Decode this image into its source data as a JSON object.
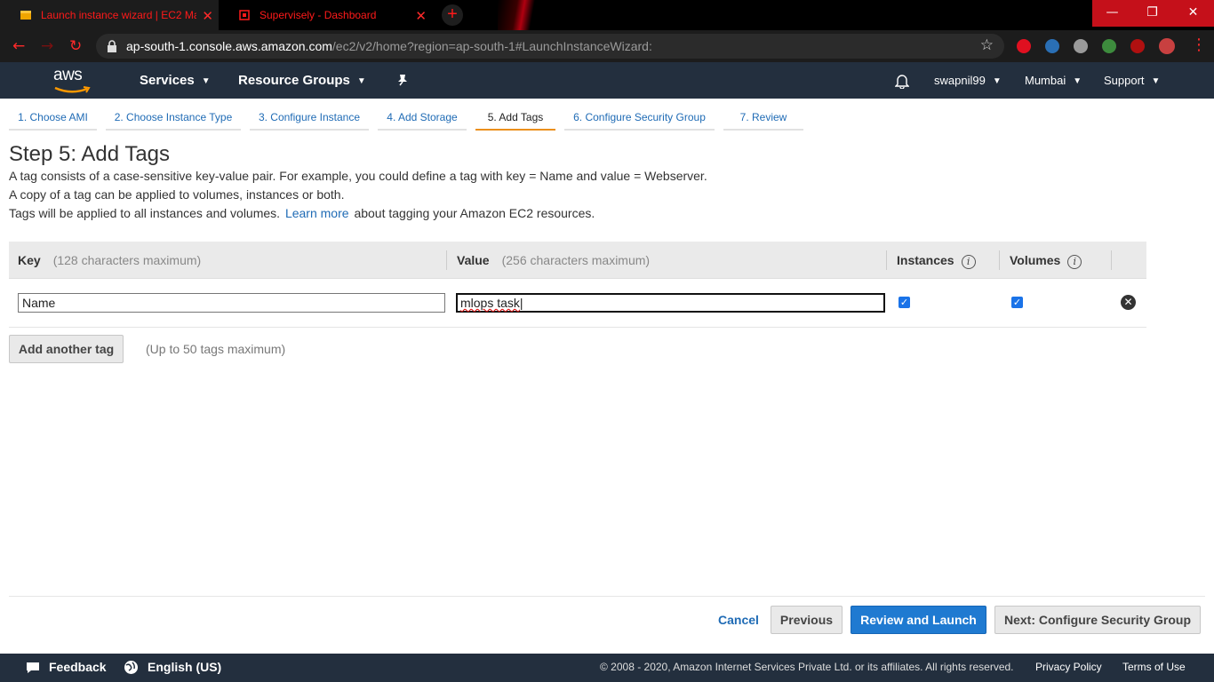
{
  "browser": {
    "tabs": [
      {
        "title": "Launch instance wizard | EC2 Ma",
        "icon": "aws-box-icon"
      },
      {
        "title": "Supervisely - Dashboard",
        "icon": "supervisely-icon"
      }
    ],
    "new_tab": "+",
    "url_host": "ap-south-1.console.aws.amazon.com",
    "url_path": "/ec2/v2/home?region=ap-south-1#LaunchInstanceWizard:"
  },
  "header": {
    "logo": "aws",
    "services": "Services",
    "resource_groups": "Resource Groups",
    "user": "swapnil99",
    "region": "Mumbai",
    "support": "Support"
  },
  "wizard": {
    "steps": [
      "1. Choose AMI",
      "2. Choose Instance Type",
      "3. Configure Instance",
      "4. Add Storage",
      "5. Add Tags",
      "6. Configure Security Group",
      "7. Review"
    ],
    "active_step": "5. Add Tags"
  },
  "page": {
    "title": "Step 5: Add Tags",
    "desc1": "A tag consists of a case-sensitive key-value pair. For example, you could define a tag with key = Name and value = Webserver.",
    "desc2": "A copy of a tag can be applied to volumes, instances or both.",
    "desc3_pre": "Tags will be applied to all instances and volumes.",
    "learn_more": "Learn more",
    "desc3_post": "about tagging your Amazon EC2 resources."
  },
  "table": {
    "key_header": "Key",
    "key_hint": "(128 characters maximum)",
    "value_header": "Value",
    "value_hint": "(256 characters maximum)",
    "instances_header": "Instances",
    "volumes_header": "Volumes",
    "rows": [
      {
        "key": "Name",
        "value": "mlops task",
        "instances": true,
        "volumes": true
      }
    ]
  },
  "actions": {
    "add_tag": "Add another tag",
    "add_tag_note": "(Up to 50 tags maximum)",
    "cancel": "Cancel",
    "previous": "Previous",
    "review_launch": "Review and Launch",
    "next": "Next: Configure Security Group"
  },
  "footer": {
    "feedback": "Feedback",
    "language": "English (US)",
    "copyright": "© 2008 - 2020, Amazon Internet Services Private Ltd. or its affiliates. All rights reserved.",
    "privacy": "Privacy Policy",
    "terms": "Terms of Use"
  },
  "colors": {
    "aws_navy": "#232f3e",
    "link_blue": "#1f6bb5",
    "primary_button": "#1f7ad1",
    "active_step_underline": "#eb8f1c",
    "browser_accent": "#ff1a1a"
  }
}
